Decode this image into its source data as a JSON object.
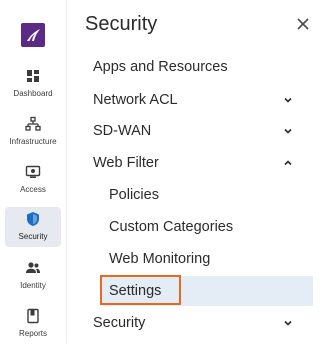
{
  "rail": {
    "items": [
      {
        "label": "Dashboard",
        "icon": "dashboard-icon"
      },
      {
        "label": "Infrastructure",
        "icon": "infrastructure-icon"
      },
      {
        "label": "Access",
        "icon": "access-icon"
      },
      {
        "label": "Security",
        "icon": "shield-icon",
        "active": true
      },
      {
        "label": "Identity",
        "icon": "identity-icon"
      },
      {
        "label": "Reports",
        "icon": "reports-icon"
      }
    ]
  },
  "panel": {
    "title": "Security",
    "menu": [
      {
        "label": "Apps and Resources"
      },
      {
        "label": "Network ACL",
        "chevron": "down"
      },
      {
        "label": "SD-WAN",
        "chevron": "down"
      },
      {
        "label": "Web Filter",
        "chevron": "up",
        "expanded": true
      },
      {
        "label": "Policies"
      },
      {
        "label": "Custom Categories"
      },
      {
        "label": "Web Monitoring"
      },
      {
        "label": "Settings",
        "selected": true
      },
      {
        "label": "Security",
        "chevron": "down"
      }
    ]
  },
  "colors": {
    "brand": "#5b2a86",
    "accent": "#1a6fc4",
    "selected_bg": "#e4ecf6",
    "highlight": "#e86a1f"
  }
}
